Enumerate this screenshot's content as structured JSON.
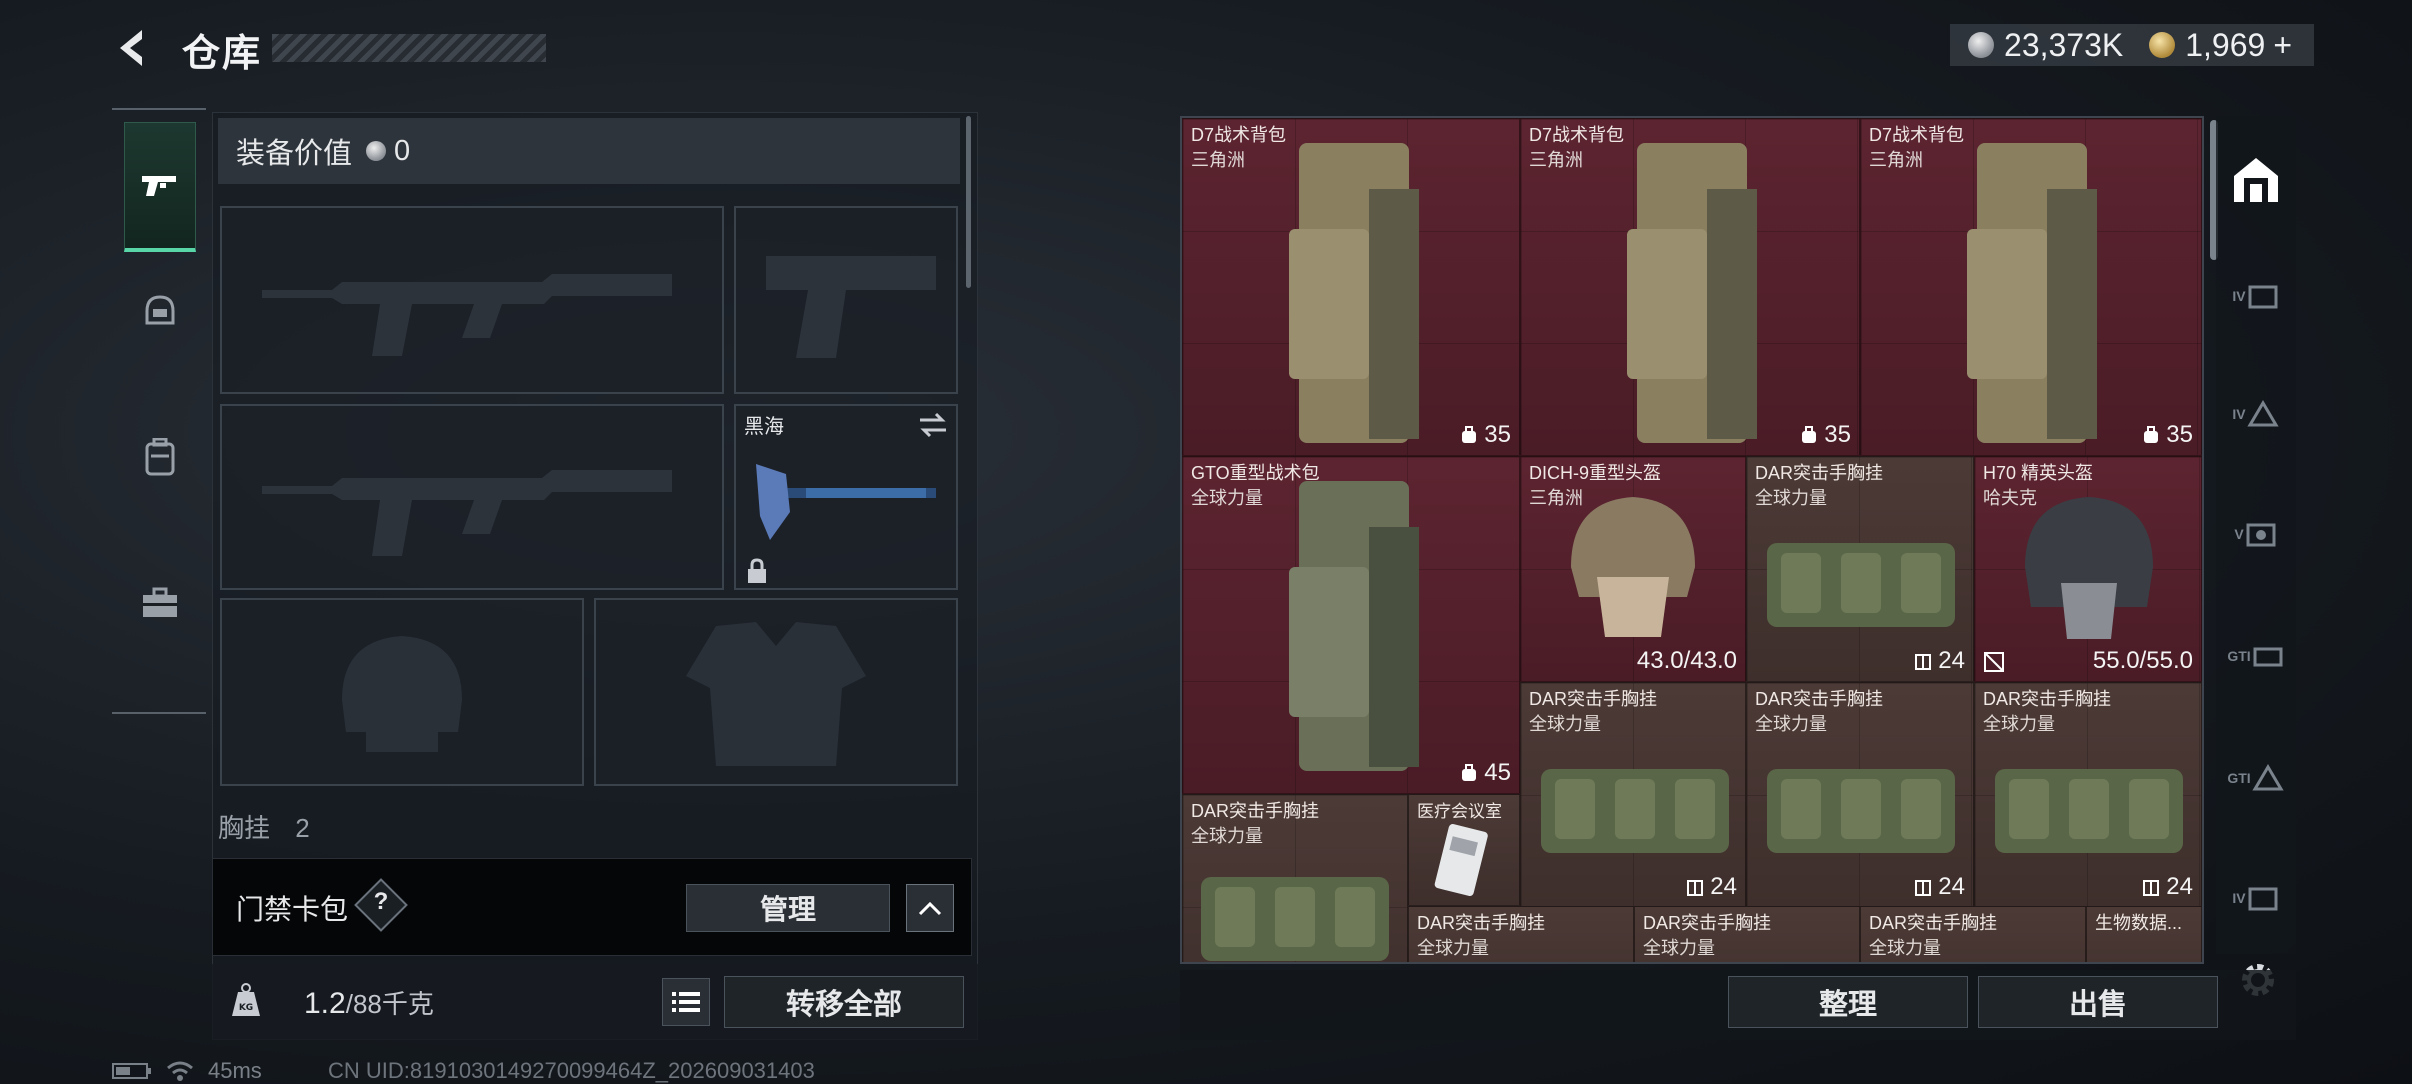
{
  "header": {
    "title": "仓库"
  },
  "currency": {
    "silver": "23,373K",
    "gold": "1,969",
    "gold_plus": "+"
  },
  "loadout": {
    "equip_value_label": "装备价值",
    "equip_value": "0",
    "melee_name": "黑海",
    "chest_label": "胸挂",
    "chest_count": "2",
    "keycard_label": "门禁卡包",
    "keycard_help": "?",
    "manage_label": "管理",
    "weight_current": "1.2",
    "weight_max": "/88千克",
    "transfer_all_label": "转移全部"
  },
  "inventory": {
    "items": [
      {
        "name": "D7战术背包",
        "sub": "三角洲",
        "stat": "35",
        "color": "#5c2430"
      },
      {
        "name": "D7战术背包",
        "sub": "三角洲",
        "stat": "35",
        "color": "#5c2430"
      },
      {
        "name": "D7战术背包",
        "sub": "三角洲",
        "stat": "35",
        "color": "#5c2430"
      },
      {
        "name": "GTO重型战术包",
        "sub": "全球力量",
        "stat": "45",
        "color": "#5c2430"
      },
      {
        "name": "DICH-9重型头盔",
        "sub": "三角洲",
        "stat": "43.0/43.0",
        "color": "#5c2430"
      },
      {
        "name": "DAR突击手胸挂",
        "sub": "全球力量",
        "stat": "24",
        "color": "#4c3a36"
      },
      {
        "name": "H70 精英头盔",
        "sub": "哈夫克",
        "stat": "55.0/55.0",
        "color": "#5c2430"
      },
      {
        "name": "DAR突击手胸挂",
        "sub": "全球力量",
        "stat": "24",
        "color": "#4c3a36"
      },
      {
        "name": "DAR突击手胸挂",
        "sub": "全球力量",
        "stat": "24",
        "color": "#4c3a36"
      },
      {
        "name": "DAR突击手胸挂",
        "sub": "全球力量",
        "stat": "24",
        "color": "#4c3a36"
      },
      {
        "name": "DAR突击手胸挂",
        "sub": "全球力量",
        "stat": "",
        "color": "#4c3a36"
      },
      {
        "name": "医疗会议室",
        "sub": "",
        "stat": "",
        "color": "#4c3a36"
      },
      {
        "name": "DAR突击手胸挂",
        "sub": "全球力量",
        "stat": "",
        "color": "#4c3a36"
      },
      {
        "name": "DAR突击手胸挂",
        "sub": "全球力量",
        "stat": "",
        "color": "#4c3a36"
      },
      {
        "name": "DAR突击手胸挂",
        "sub": "全球力量",
        "stat": "",
        "color": "#4c3a36"
      },
      {
        "name": "生物数据...",
        "sub": "",
        "stat": "",
        "color": "#4c3a36"
      }
    ]
  },
  "side_rail": [
    "IV",
    "IV",
    "V",
    "GTI",
    "GTI",
    "IV"
  ],
  "footer": {
    "sort_label": "整理",
    "sell_label": "出售"
  },
  "status": {
    "ping": "45ms",
    "uid": "CN UID:8191030149270099464Z_202609031403"
  },
  "icons": [
    "back-icon",
    "pistol-icon",
    "helmet-tab-icon",
    "backpack-tab-icon",
    "toolbox-tab-icon",
    "lock-icon",
    "swap-icon",
    "weight-icon",
    "list-icon",
    "settings-icon",
    "warehouse-icon"
  ]
}
